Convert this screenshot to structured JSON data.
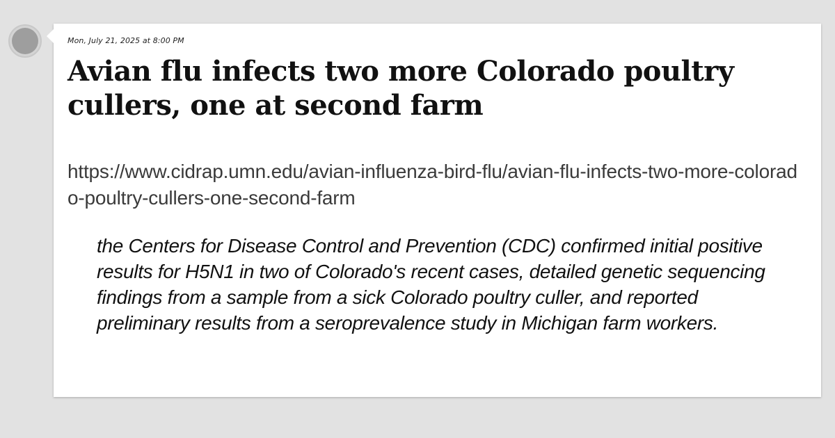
{
  "post": {
    "timestamp": "Mon, July 21, 2025 at 8:00 PM",
    "title": "Avian flu infects two more Colorado poultry cullers, one at second farm",
    "url": "https://www.cidrap.umn.edu/avian-influenza-bird-flu/avian-flu-infects-two-more-colorado-poultry-cullers-one-second-farm",
    "quote": "the Centers for Disease Control and Prevention (CDC) confirmed initial positive results for H5N1 in two of Colorado's recent cases, detailed genetic sequencing findings from a sample from a sick Colorado poultry culler, and reported preliminary results from a seroprevalence study in Michigan farm workers."
  },
  "colors": {
    "page_background": "#e2e2e2",
    "card_background": "#ffffff",
    "avatar": "#9e9e9e"
  }
}
